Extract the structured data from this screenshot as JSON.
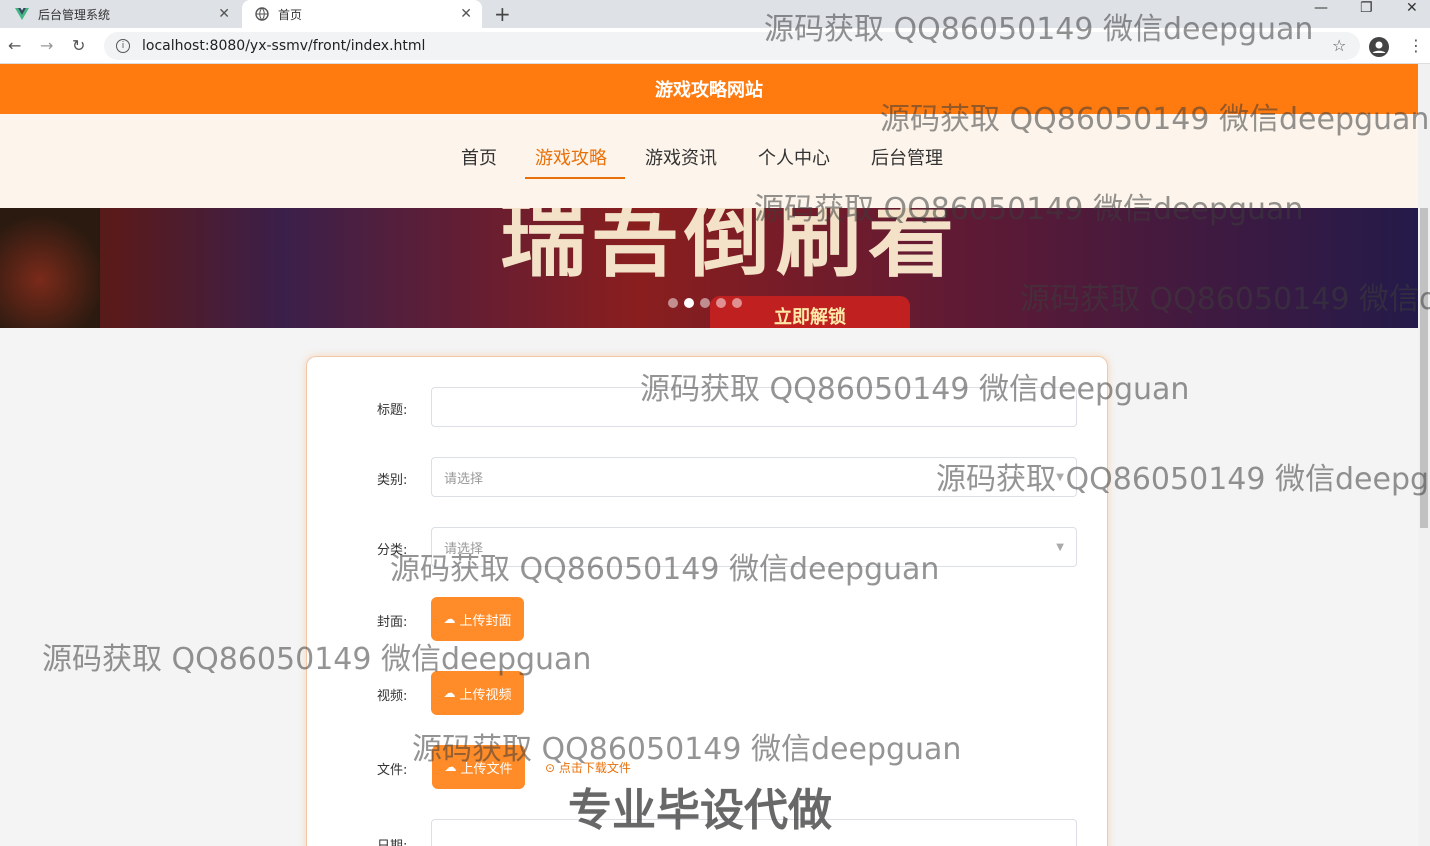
{
  "browser": {
    "tabs": [
      {
        "title": "后台管理系统"
      },
      {
        "title": "首页"
      }
    ],
    "url": "localhost:8080/yx-ssmv/front/index.html"
  },
  "header": {
    "site_title": "游戏攻略网站"
  },
  "nav": {
    "items": [
      {
        "label": "首页"
      },
      {
        "label": "游戏攻略",
        "active": true
      },
      {
        "label": "游戏资讯"
      },
      {
        "label": "个人中心"
      },
      {
        "label": "后台管理"
      }
    ]
  },
  "banner": {
    "headline": "瑞吾倒刷看",
    "unlock_label": "立即解锁"
  },
  "form": {
    "title_label": "标题:",
    "category_label": "类别:",
    "category_placeholder": "请选择",
    "classify_label": "分类:",
    "classify_placeholder": "请选择",
    "cover_label": "封面:",
    "cover_button": "上传封面",
    "video_label": "视频:",
    "video_button": "上传视频",
    "file_label": "文件:",
    "file_button": "上传文件",
    "download_link": "点击下载文件",
    "date_label": "日期:"
  },
  "watermarks": {
    "text": "源码获取 QQ86050149 微信deepguan",
    "big": "专业毕设代做"
  },
  "colors": {
    "brand": "#ff7a0f",
    "button": "#ff8c28",
    "menu_bg": "#fdf5ec"
  }
}
